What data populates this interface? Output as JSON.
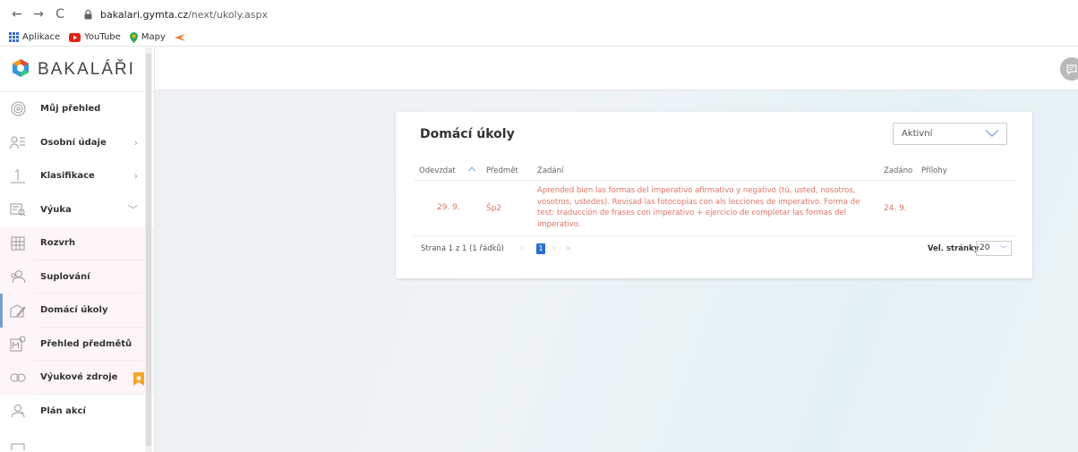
{
  "browser": {
    "url_domain": "bakalari.gymta.cz",
    "url_path": "/next/ukoly.aspx",
    "bookmarks": [
      "Aplikace",
      "YouTube",
      "Mapy"
    ]
  },
  "sidebar": {
    "logo": "BAKALÁŘI",
    "items": [
      {
        "label": "Můj přehled",
        "icon": "target-icon"
      },
      {
        "label": "Osobní údaje",
        "icon": "person-list-icon"
      },
      {
        "label": "Klasifikace",
        "icon": "grade-one-icon"
      },
      {
        "label": "Výuka",
        "icon": "book-search-icon"
      },
      {
        "label": "Rozvrh",
        "icon": "schedule-icon"
      },
      {
        "label": "Suplování",
        "icon": "people-icon"
      },
      {
        "label": "Domácí úkoly",
        "icon": "homework-icon"
      },
      {
        "label": "Přehled předmětů",
        "icon": "subjects-icon"
      },
      {
        "label": "Výukové zdroje",
        "icon": "link-icon"
      },
      {
        "label": "Plán akcí",
        "icon": "events-icon"
      }
    ]
  },
  "homework": {
    "title": "Domácí úkoly",
    "filter": "Aktivní",
    "columns": {
      "due": "Odevzdat",
      "subject": "Předmět",
      "task": "Zadání",
      "assigned": "Zadáno",
      "attachments": "Přílohy"
    },
    "rows": [
      {
        "due": "29. 9.",
        "subject": "Šp2",
        "task": "Aprended bien las formas del imperativo afirmativo y negativo (tú, usted, nosotros, vosotros, ustedes). Revisad las fotocopias con als lecciones de imperativo. Forma de test: traducción de frases con imperativo + ejercicio de completar las formas del imperativo.",
        "assigned": "24. 9.",
        "attachments": ""
      }
    ],
    "pager": {
      "info": "Strana 1 z 1 (1 řádků)",
      "first": "«",
      "prev": "‹",
      "current": "1",
      "next": "›",
      "last": "»",
      "page_size_label": "Vel. stránky",
      "page_size": "20"
    }
  },
  "colors": {
    "accent_red": "#e37464",
    "pager_active": "#2b6ecf",
    "logo_colors": [
      "#e5493a",
      "#f39c12",
      "#2ecc71",
      "#3498db"
    ]
  }
}
